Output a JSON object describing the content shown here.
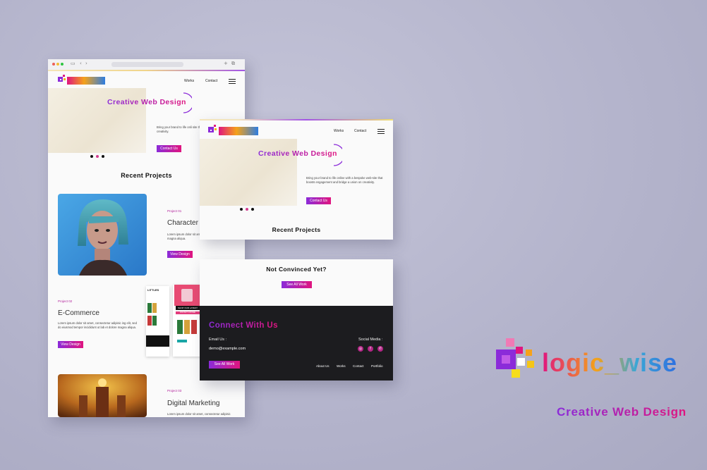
{
  "browser": {
    "nav": {
      "works": "Works",
      "contact": "Contact"
    },
    "logo": "logic_wise",
    "hero": {
      "title": "Creative Web Design",
      "text": "Bring your brand to life onli site that boosts engagement an creativity.",
      "cta": "Contact Us"
    },
    "recent_title": "Recent Projects",
    "projects": [
      {
        "label": "Project 01",
        "title": "Character",
        "text": "Lorem ipsum dolor sit amet, sed do eiusmod tem labore magna aliqua.",
        "button": "View Design"
      },
      {
        "label": "Project 02",
        "title": "E-Commerce",
        "text": "Lorem ipsum dolor sit amet, consectetur adipisic ing elit, sed do eiusmod tempor incididunt ut lab et dolore magna aliqua.",
        "button": "View Design"
      },
      {
        "label": "Project 03",
        "title": "Digital Marketing",
        "text": "Lorem ipsum dolor sit amet, consectetur adipisic"
      }
    ],
    "phone_texts": [
      "LITTLES",
      "SHOP OUR LATEST",
      "INSTANT COFFEE"
    ]
  },
  "panel_top": {
    "logo": "logic_wise",
    "nav": {
      "works": "Works",
      "contact": "Contact"
    },
    "hero": {
      "title": "Creative Web Design",
      "text": "Bring your brand to life online with a bespoke web-site that boosts engagement and bridge a union on creativity.",
      "cta": "Contact Us"
    },
    "recent_title": "Recent Projects"
  },
  "panel_bottom": {
    "heading": "Not Convinced Yet?",
    "see_all": "See All Work",
    "connect_title": "Connect With Us",
    "email_label": "Email Us :",
    "email": "demo@example.com",
    "social_label": "Social Media :",
    "see_all_footer": "See All Work",
    "footer_links": [
      "About Us",
      "Works",
      "Contact",
      "Portfolio"
    ]
  },
  "brand": {
    "logo": "logic_wise",
    "tagline": "Creative Web Design"
  },
  "colors": {
    "purple": "#8b2bd9",
    "pink": "#e0157f",
    "dark_footer": "#1c1c1f",
    "background": "#b3b3cb"
  }
}
